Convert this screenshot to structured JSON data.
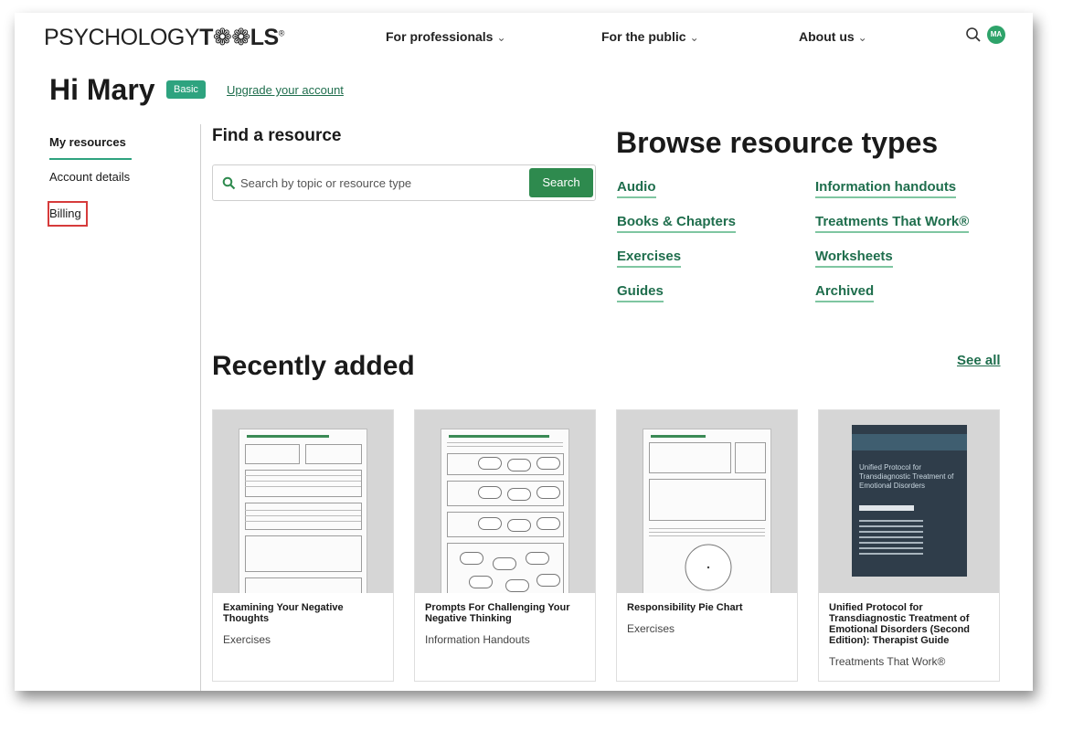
{
  "header": {
    "logo_light": "PSYCHOLOGY",
    "logo_bold": "T❁❁LS",
    "logo_reg": "®",
    "nav": [
      {
        "label": "For professionals",
        "chevron": "⌄"
      },
      {
        "label": "For the public",
        "chevron": "⌄"
      },
      {
        "label": "About us",
        "chevron": "⌄"
      }
    ],
    "search_icon": "search-icon",
    "avatar_initials": "MA",
    "avatar_color": "#2ea36a"
  },
  "greeting": {
    "title": "Hi Mary",
    "badge": "Basic",
    "upgrade_link": "Upgrade your account"
  },
  "sidebar": {
    "items": [
      "My resources",
      "Account details",
      "Billing"
    ],
    "active": "My resources"
  },
  "find": {
    "title": "Find a resource",
    "placeholder": "Search by topic or resource type",
    "button": "Search"
  },
  "browse": {
    "title": "Browse resource types",
    "left": [
      "Audio",
      "Books & Chapters",
      "Exercises",
      "Guides"
    ],
    "right": [
      "Information handouts",
      "Treatments That Work®",
      "Worksheets",
      "Archived"
    ]
  },
  "recent": {
    "title": "Recently added",
    "see_all": "See all",
    "cards": [
      {
        "title": "Examining Your Negative Thoughts",
        "category": "Exercises"
      },
      {
        "title": "Prompts For Challenging Your Negative Thinking",
        "category": "Information Handouts"
      },
      {
        "title": "Responsibility Pie Chart",
        "category": "Exercises"
      },
      {
        "title": "Unified Protocol for Transdiagnostic Treatment of Emotional Disorders (Second Edition): Therapist Guide",
        "category": "Treatments That Work®",
        "cover_title": "Unified Protocol for Transdiagnostic Treatment of Emotional Disorders"
      }
    ]
  },
  "colors": {
    "accent": "#2ea37f",
    "link": "#1f6e4d",
    "search_button": "#2e8a4e",
    "highlight": "#d63b3b"
  }
}
